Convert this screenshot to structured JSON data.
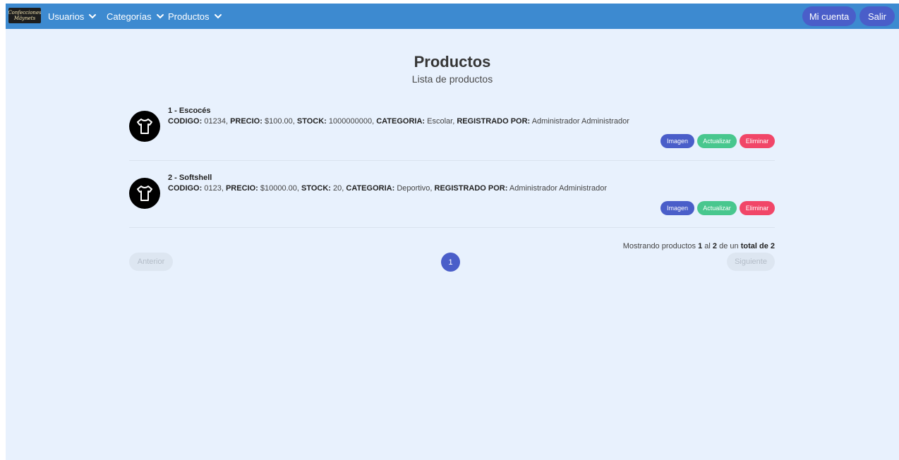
{
  "brand": {
    "logo_line1": "Confecciones",
    "logo_line2": "Mäynets"
  },
  "nav": {
    "items": [
      {
        "label": "Usuarios"
      },
      {
        "label": "Categorías"
      },
      {
        "label": "Productos"
      }
    ],
    "account_label": "Mi cuenta",
    "logout_label": "Salir"
  },
  "page": {
    "title": "Productos",
    "subtitle": "Lista de productos"
  },
  "labels": {
    "codigo": "CODIGO:",
    "precio": "PRECIO:",
    "stock": "STOCK:",
    "categoria": "CATEGORIA:",
    "registrado": "REGISTRADO POR:"
  },
  "actions": {
    "image": "Imagen",
    "update": "Actualizar",
    "delete": "Eliminar"
  },
  "products": [
    {
      "title": "1 - Escocés",
      "codigo": "01234",
      "precio": "$100.00",
      "stock": "1000000000",
      "categoria": "Escolar",
      "registrado": "Administrador Administrador"
    },
    {
      "title": "2 - Softshell",
      "codigo": "0123",
      "precio": "$10000.00",
      "stock": "20",
      "categoria": "Deportivo",
      "registrado": "Administrador Administrador"
    }
  ],
  "pagination": {
    "summary_prefix": "Mostrando productos",
    "from": "1",
    "al": "al",
    "to": "2",
    "de_un": "de un",
    "total_label": "total de 2",
    "previous": "Anterior",
    "next": "Siguiente",
    "current_page": "1"
  },
  "colors": {
    "navbar": "#3d8ad0",
    "primary": "#4a5ec9",
    "success": "#48c78e",
    "danger": "#f14668",
    "background": "#e8f1fd"
  },
  "icons": {
    "product": "tshirt-icon",
    "dropdown": "chevron-down-icon"
  }
}
